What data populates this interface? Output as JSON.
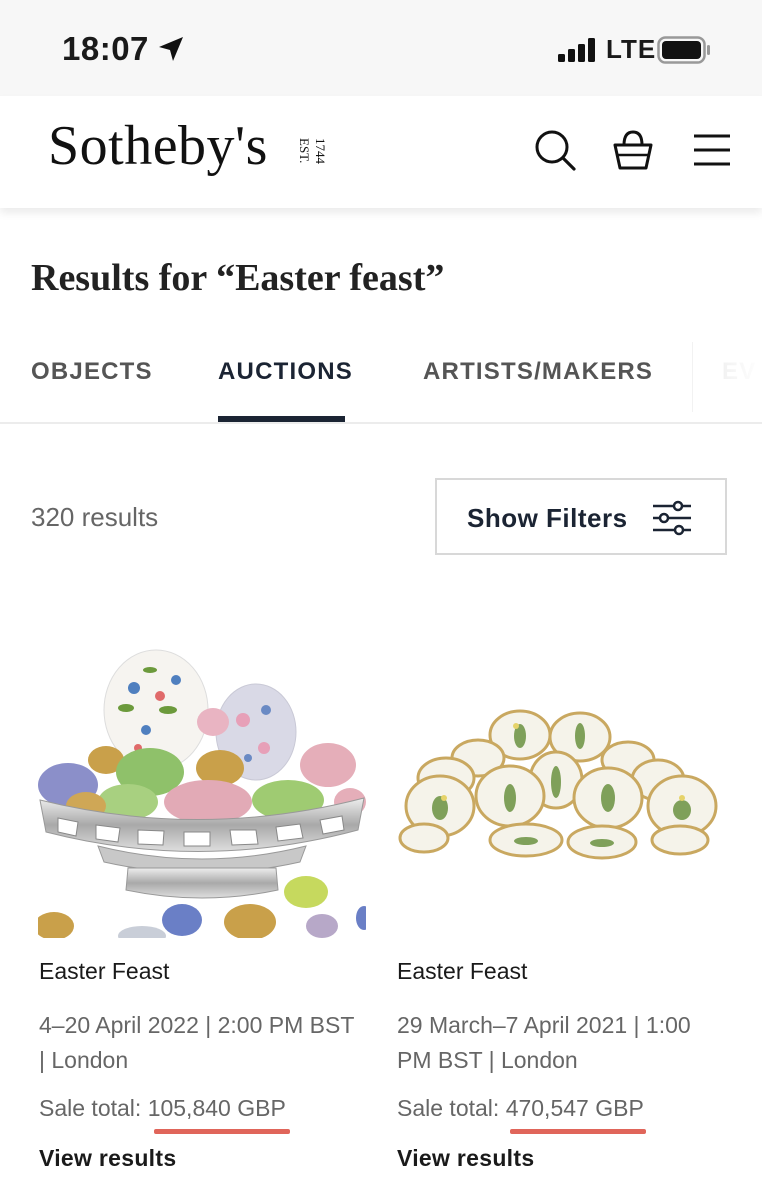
{
  "status_bar": {
    "time": "18:07",
    "network": "LTE",
    "icons": [
      "location-arrow-icon",
      "signal-icon",
      "battery-icon"
    ]
  },
  "header": {
    "logo": "Sotheby's",
    "logo_est": "EST.",
    "logo_year": "1744",
    "icons": [
      "search-icon",
      "bag-icon",
      "menu-icon"
    ]
  },
  "results": {
    "heading": "Results for “Easter feast”",
    "count": "320 results",
    "filter_label": "Show Filters"
  },
  "tabs": [
    {
      "label": "OBJECTS",
      "active": false
    },
    {
      "label": "AUCTIONS",
      "active": true
    },
    {
      "label": "ARTISTS/MAKERS",
      "active": false
    },
    {
      "label": "EV",
      "active": false
    }
  ],
  "accent_color": "#1b2433",
  "highlight_color": "#e0655a",
  "cards": [
    {
      "title": "Easter Feast",
      "date": "4–20 April 2022 | 2:00 PM BST | London",
      "total_label": "Sale total: ",
      "total_amount": "105,840 GBP",
      "link": "View results",
      "image": "easter-eggs-silver-bowl"
    },
    {
      "title": "Easter Feast",
      "date": "29 March–7 April 2021 | 1:00 PM BST | London",
      "total_label": "Sale total: ",
      "total_amount": "470,547 GBP",
      "link": "View results",
      "image": "flora-danica-plates"
    }
  ]
}
